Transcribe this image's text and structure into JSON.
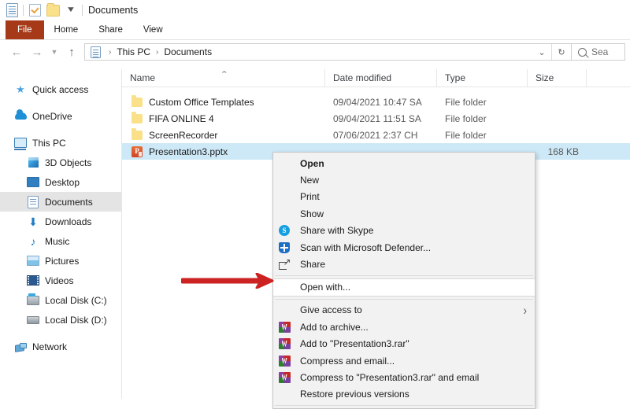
{
  "titlebar": {
    "title": "Documents",
    "icons": [
      "documents-icon",
      "properties-icon",
      "new-folder-icon",
      "customize-quick-access-chevron"
    ]
  },
  "ribbon": {
    "tabs": [
      {
        "label": "File",
        "active_color": "#a63a18"
      },
      {
        "label": "Home"
      },
      {
        "label": "Share"
      },
      {
        "label": "View"
      }
    ]
  },
  "addressbar": {
    "back_icon": "back-arrow-icon",
    "forward_icon": "forward-arrow-icon",
    "recent_icon": "recent-locations-chevron-icon",
    "up_icon": "up-arrow-icon",
    "path_icon": "documents-icon",
    "breadcrumbs": [
      "This PC",
      "Documents"
    ],
    "separator": "›",
    "dropdown_icon": "chevron-down-icon",
    "refresh_icon": "refresh-icon",
    "search_placeholder": "Sea"
  },
  "sidebar": {
    "items": [
      {
        "label": "Quick access",
        "icon": "star-icon",
        "indent": false,
        "selected": false
      },
      {
        "label": "OneDrive",
        "icon": "cloud-icon",
        "indent": false,
        "selected": false
      },
      {
        "label": "This PC",
        "icon": "computer-icon",
        "indent": false,
        "selected": false
      },
      {
        "label": "3D Objects",
        "icon": "3d-objects-icon",
        "indent": true,
        "selected": false
      },
      {
        "label": "Desktop",
        "icon": "desktop-icon",
        "indent": true,
        "selected": false
      },
      {
        "label": "Documents",
        "icon": "documents-icon",
        "indent": true,
        "selected": true
      },
      {
        "label": "Downloads",
        "icon": "downloads-icon",
        "indent": true,
        "selected": false
      },
      {
        "label": "Music",
        "icon": "music-icon",
        "indent": true,
        "selected": false
      },
      {
        "label": "Pictures",
        "icon": "pictures-icon",
        "indent": true,
        "selected": false
      },
      {
        "label": "Videos",
        "icon": "videos-icon",
        "indent": true,
        "selected": false
      },
      {
        "label": "Local Disk (C:)",
        "icon": "local-disk-c-icon",
        "indent": true,
        "selected": false
      },
      {
        "label": "Local Disk (D:)",
        "icon": "local-disk-d-icon",
        "indent": true,
        "selected": false
      },
      {
        "label": "Network",
        "icon": "network-icon",
        "indent": false,
        "selected": false
      }
    ]
  },
  "filelist": {
    "columns": [
      "Name",
      "Date modified",
      "Type",
      "Size"
    ],
    "sort_indicator": "ascending-caret",
    "rows": [
      {
        "name": "Custom Office Templates",
        "date": "09/04/2021 10:47 SA",
        "type": "File folder",
        "size": "",
        "icon": "folder-icon",
        "selected": false
      },
      {
        "name": "FIFA ONLINE 4",
        "date": "09/04/2021 11:51 SA",
        "type": "File folder",
        "size": "",
        "icon": "folder-icon",
        "selected": false
      },
      {
        "name": "ScreenRecorder",
        "date": "07/06/2021 2:37 CH",
        "type": "File folder",
        "size": "",
        "icon": "folder-icon",
        "selected": false
      },
      {
        "name": "Presentation3.pptx",
        "date": "",
        "type": "",
        "size": "168 KB",
        "icon": "powerpoint-file-icon",
        "selected": true
      }
    ]
  },
  "context_menu": {
    "items": [
      {
        "label": "Open",
        "icon": "",
        "bold": true,
        "highlighted": false,
        "separator_before": false,
        "submenu": false
      },
      {
        "label": "New",
        "icon": "",
        "bold": false,
        "highlighted": false,
        "separator_before": false,
        "submenu": false
      },
      {
        "label": "Print",
        "icon": "",
        "bold": false,
        "highlighted": false,
        "separator_before": false,
        "submenu": false
      },
      {
        "label": "Show",
        "icon": "",
        "bold": false,
        "highlighted": false,
        "separator_before": false,
        "submenu": false
      },
      {
        "label": "Share with Skype",
        "icon": "skype-icon",
        "bold": false,
        "highlighted": false,
        "separator_before": false,
        "submenu": false
      },
      {
        "label": "Scan with Microsoft Defender...",
        "icon": "defender-shield-icon",
        "bold": false,
        "highlighted": false,
        "separator_before": false,
        "submenu": false
      },
      {
        "label": "Share",
        "icon": "share-icon",
        "bold": false,
        "highlighted": false,
        "separator_before": false,
        "submenu": false
      },
      {
        "label": "Open with...",
        "icon": "",
        "bold": false,
        "highlighted": true,
        "separator_before": true,
        "submenu": false
      },
      {
        "label": "Give access to",
        "icon": "",
        "bold": false,
        "highlighted": false,
        "separator_before": true,
        "submenu": true
      },
      {
        "label": "Add to archive...",
        "icon": "winrar-icon",
        "bold": false,
        "highlighted": false,
        "separator_before": false,
        "submenu": false
      },
      {
        "label": "Add to \"Presentation3.rar\"",
        "icon": "winrar-icon",
        "bold": false,
        "highlighted": false,
        "separator_before": false,
        "submenu": false
      },
      {
        "label": "Compress and email...",
        "icon": "winrar-icon",
        "bold": false,
        "highlighted": false,
        "separator_before": false,
        "submenu": false
      },
      {
        "label": "Compress to \"Presentation3.rar\" and email",
        "icon": "winrar-icon",
        "bold": false,
        "highlighted": false,
        "separator_before": false,
        "submenu": false
      },
      {
        "label": "Restore previous versions",
        "icon": "",
        "bold": false,
        "highlighted": false,
        "separator_before": false,
        "submenu": false
      }
    ],
    "submenu_arrow": "›"
  },
  "annotation": {
    "arrow_color": "#cc2222",
    "arrow_name": "red-pointer-arrow",
    "points_at": "Open with..."
  }
}
